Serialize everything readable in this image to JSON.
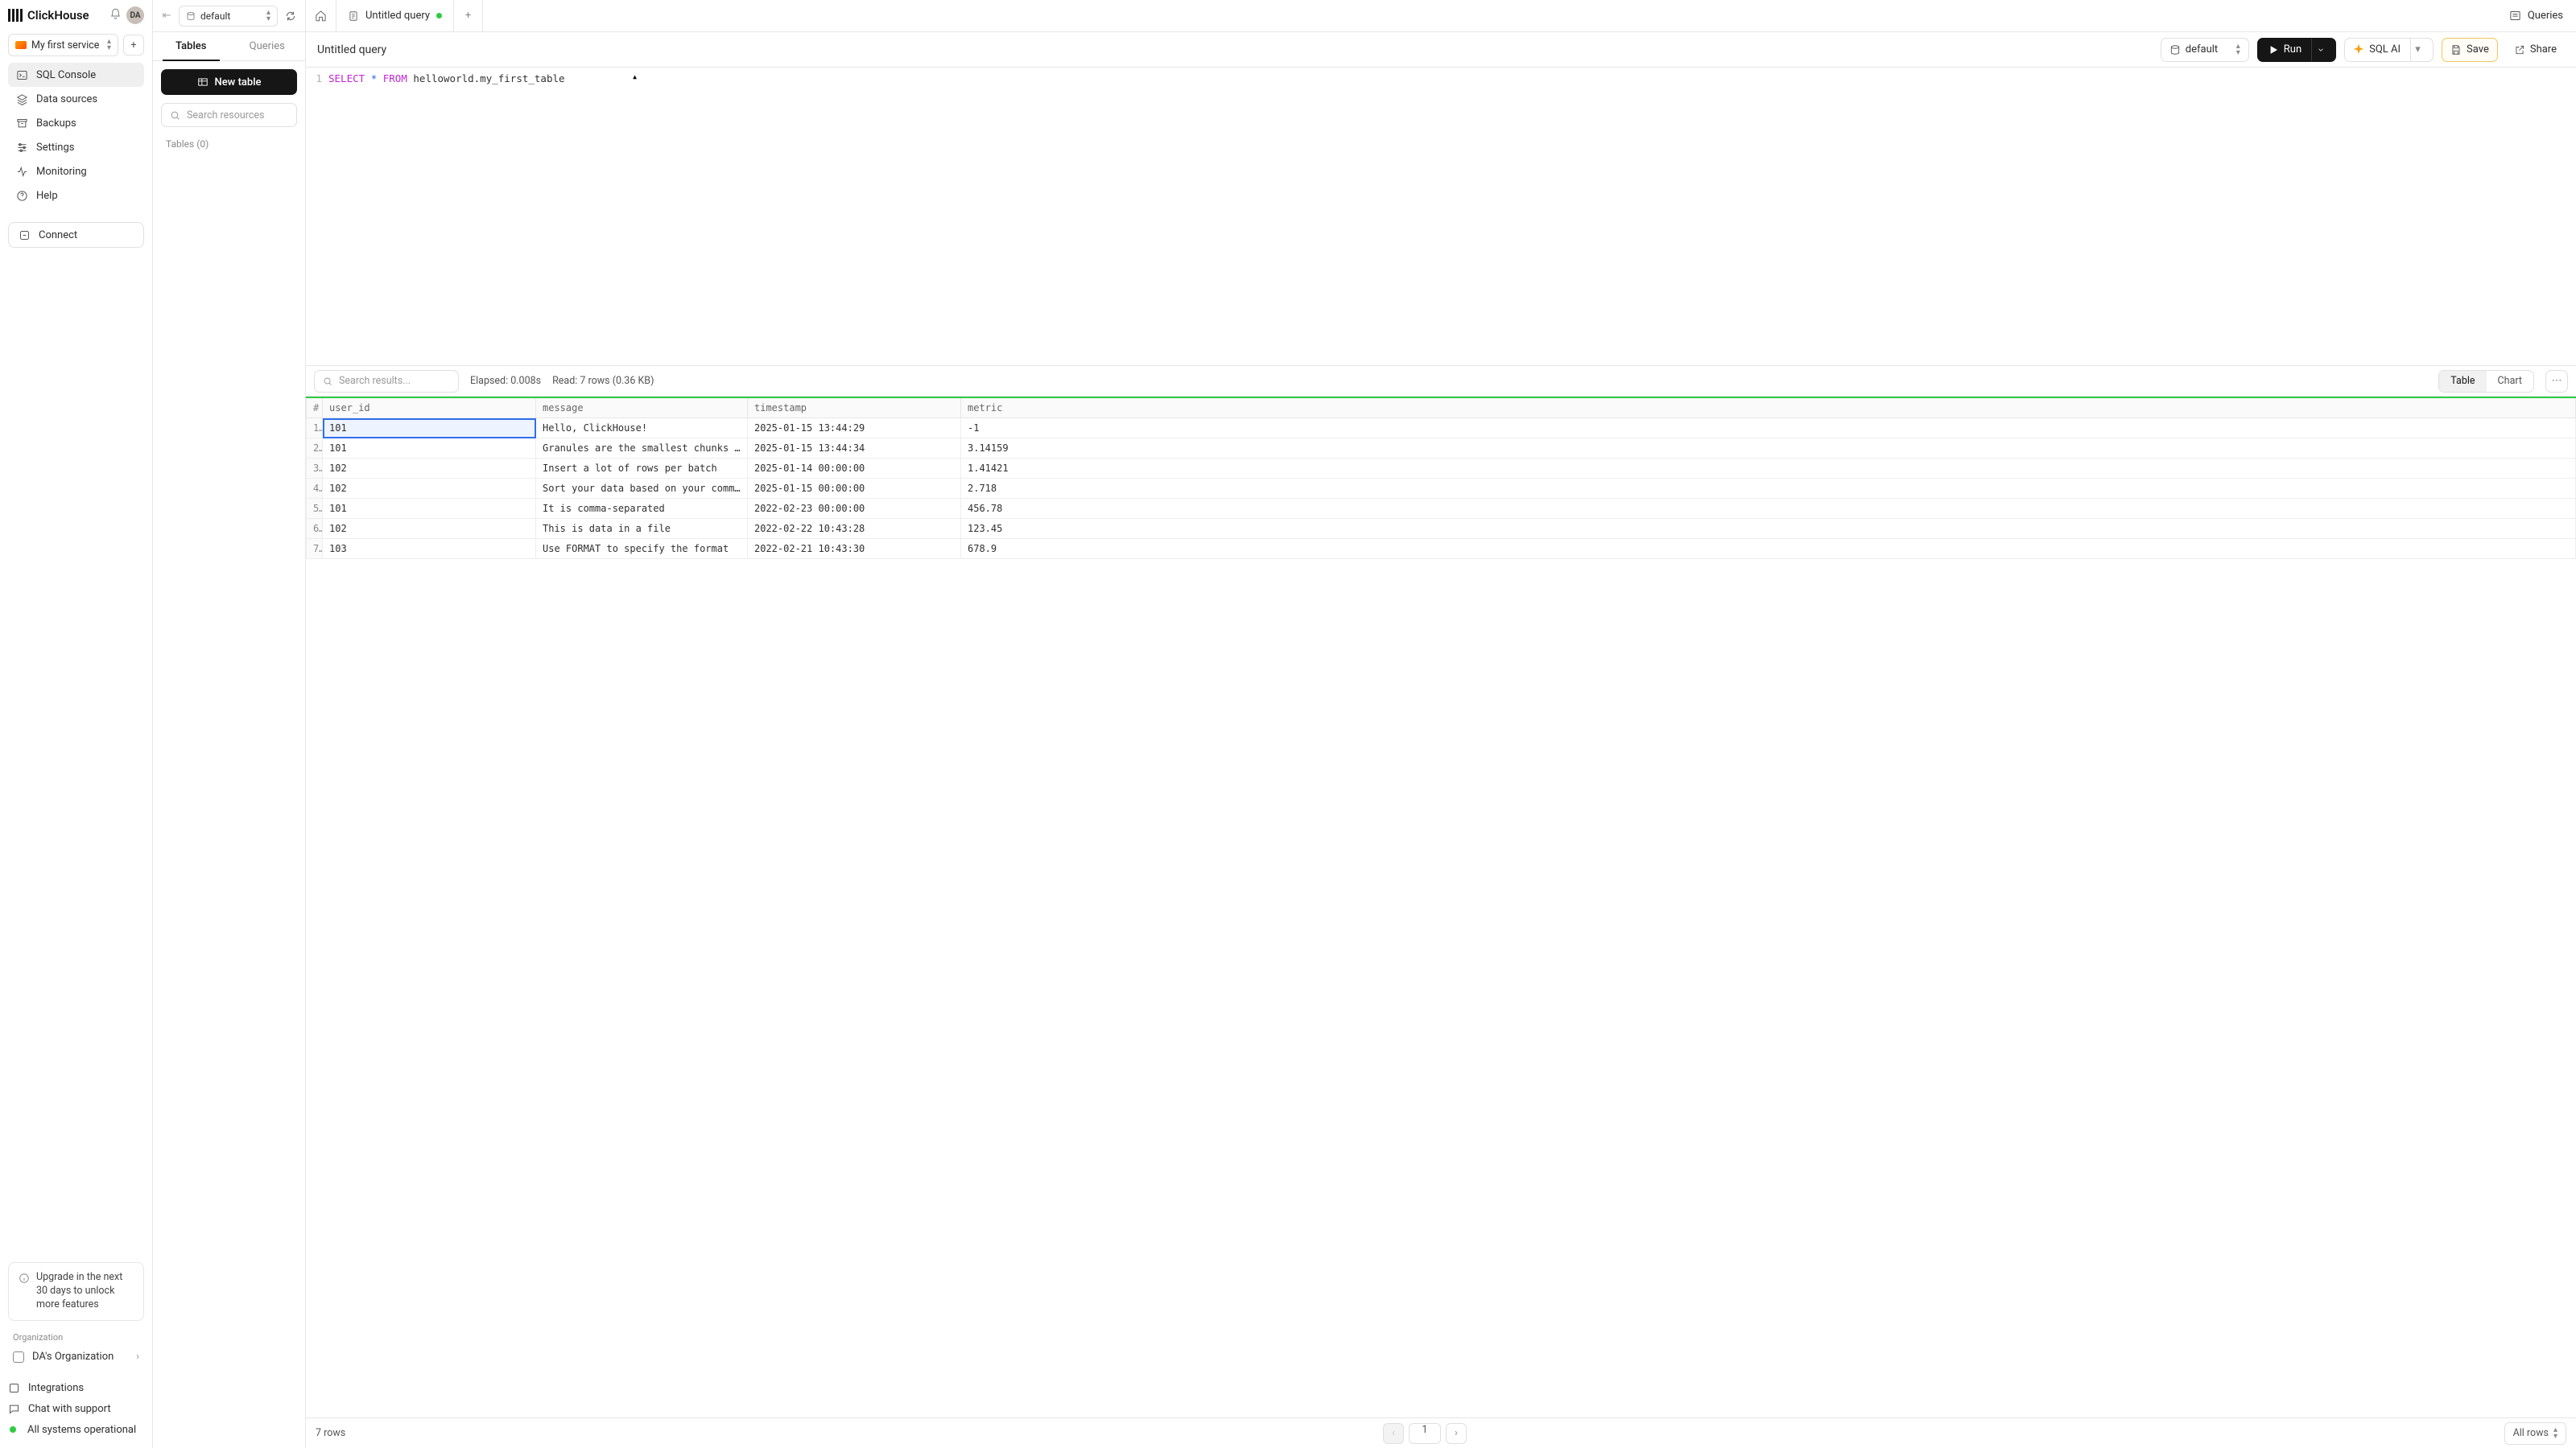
{
  "brand": "ClickHouse",
  "avatar_initials": "DA",
  "service_selector": {
    "label": "My first service"
  },
  "sidebar": {
    "items": [
      {
        "label": "SQL Console"
      },
      {
        "label": "Data sources"
      },
      {
        "label": "Backups"
      },
      {
        "label": "Settings"
      },
      {
        "label": "Monitoring"
      },
      {
        "label": "Help"
      }
    ],
    "connect_label": "Connect",
    "upgrade_text": "Upgrade in the next 30 days to unlock more features",
    "org_heading": "Organization",
    "org_name": "DA's Organization",
    "footer": {
      "integrations": "Integrations",
      "chat": "Chat with support",
      "status": "All systems operational"
    }
  },
  "tables_panel": {
    "db_selected": "default",
    "tabs": {
      "tables": "Tables",
      "queries": "Queries"
    },
    "new_table_label": "New table",
    "search_placeholder": "Search resources",
    "tables_count_label": "Tables (0)"
  },
  "tabbar": {
    "query_tab_label": "Untitled query",
    "queries_link": "Queries"
  },
  "toolbar": {
    "query_name": "Untitled query",
    "db_selected": "default",
    "run_label": "Run",
    "sqlai_label": "SQL AI",
    "save_label": "Save",
    "share_label": "Share"
  },
  "editor": {
    "line_number": "1",
    "sql": {
      "select": "SELECT",
      "star": "*",
      "from": "FROM",
      "table": "helloworld.my_first_table"
    }
  },
  "results": {
    "search_placeholder": "Search results...",
    "elapsed_label": "Elapsed: 0.008s",
    "read_label": "Read: 7 rows (0.36 KB)",
    "view_table": "Table",
    "view_chart": "Chart",
    "columns": {
      "rownum": "#",
      "user_id": "user_id",
      "message": "message",
      "timestamp": "timestamp",
      "metric": "metric"
    },
    "rows": [
      {
        "n": "1",
        "user_id": "101",
        "message": "Hello, ClickHouse!",
        "timestamp": "2025-01-15 13:44:29",
        "metric": "-1"
      },
      {
        "n": "2",
        "user_id": "101",
        "message": "Granules are the smallest chunks of data read",
        "timestamp": "2025-01-15 13:44:34",
        "metric": "3.14159"
      },
      {
        "n": "3",
        "user_id": "102",
        "message": "Insert a lot of rows per batch",
        "timestamp": "2025-01-14 00:00:00",
        "metric": "1.41421"
      },
      {
        "n": "4",
        "user_id": "102",
        "message": "Sort your data based on your commonly-used que…",
        "timestamp": "2025-01-15 00:00:00",
        "metric": "2.718"
      },
      {
        "n": "5",
        "user_id": "101",
        "message": "It is comma-separated",
        "timestamp": "2022-02-23 00:00:00",
        "metric": "456.78"
      },
      {
        "n": "6",
        "user_id": "102",
        "message": "This is data in a file",
        "timestamp": "2022-02-22 10:43:28",
        "metric": "123.45"
      },
      {
        "n": "7",
        "user_id": "103",
        "message": "Use FORMAT to specify the format",
        "timestamp": "2022-02-21 10:43:30",
        "metric": "678.9"
      }
    ],
    "footer_rows": "7 rows",
    "page_current": "1",
    "page_size_label": "All rows"
  }
}
